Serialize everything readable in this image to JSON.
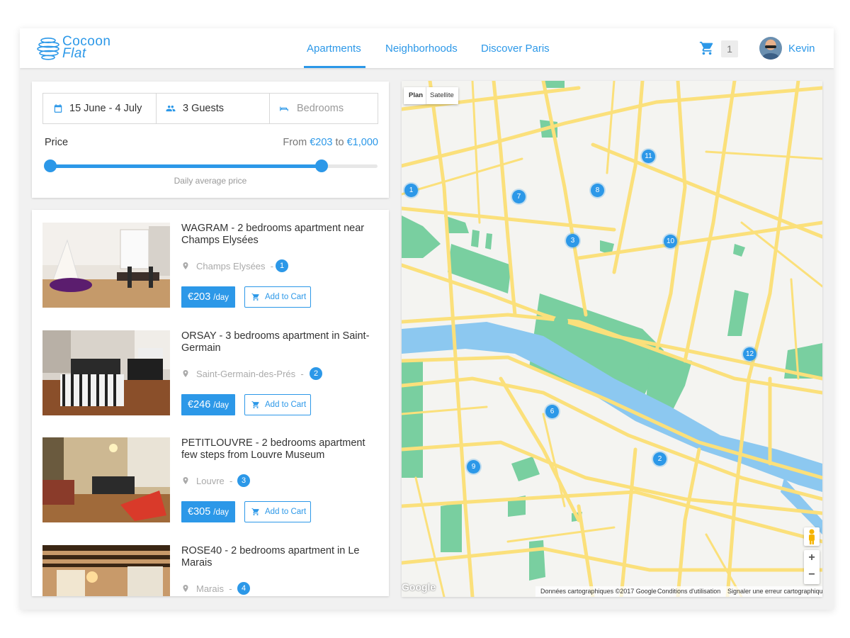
{
  "header": {
    "logo": {
      "line1": "Cocoon",
      "line2": "Flat"
    },
    "nav": [
      {
        "label": "Apartments",
        "active": true
      },
      {
        "label": "Neighborhoods",
        "active": false
      },
      {
        "label": "Discover Paris",
        "active": false
      }
    ],
    "cart_count": "1",
    "user_name": "Kevin"
  },
  "filters": {
    "dates": "15 June - 4 July",
    "guests": "3 Guests",
    "bedrooms_placeholder": "Bedrooms",
    "price_label": "Price",
    "price_from_word": "From",
    "price_min": "€203",
    "price_to_word": "to",
    "price_max": "€1,000",
    "slider_min_fraction": 0.0,
    "slider_max_fraction": 0.83,
    "slider_caption": "Daily average price"
  },
  "listings": [
    {
      "title": "WAGRAM - 2 bedrooms apartment near Champs Elysées",
      "location": "Champs Elysées",
      "separator": "-",
      "marker": "1",
      "price": "€203",
      "per": "/day",
      "cart_label": "Add to Cart"
    },
    {
      "title": "ORSAY - 3 bedrooms apartment in Saint-Germain",
      "location": "Saint-Germain-des-Prés",
      "separator": "-",
      "marker": "2",
      "price": "€246",
      "per": "/day",
      "cart_label": "Add to Cart"
    },
    {
      "title": "PETITLOUVRE - 2 bedrooms apartment few steps from Louvre Museum",
      "location": "Louvre",
      "separator": "-",
      "marker": "3",
      "price": "€305",
      "per": "/day",
      "cart_label": "Add to Cart"
    },
    {
      "title": "ROSE40 - 2 bedrooms apartment in Le Marais",
      "location": "Marais",
      "separator": "-",
      "marker": "4",
      "price": "",
      "per": "",
      "cart_label": ""
    }
  ],
  "map": {
    "type_plan": "Plan",
    "type_satellite": "Satellite",
    "markers": [
      "1",
      "2",
      "3",
      "6",
      "7",
      "8",
      "9",
      "10",
      "11",
      "12"
    ],
    "zoom_in": "+",
    "zoom_out": "−",
    "google": "Google",
    "footer_data": "Données cartographiques ©2017 Google",
    "footer_terms": "Conditions d'utilisation",
    "footer_report": "Signaler une erreur cartographique"
  },
  "colors": {
    "accent": "#2c98e8",
    "road": "#fbe07b",
    "park": "#79cfa0",
    "river": "#8cc8f0"
  }
}
